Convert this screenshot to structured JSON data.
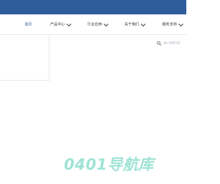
{
  "nav": {
    "items": [
      {
        "label": "首页",
        "active": true,
        "has_dropdown": false
      },
      {
        "label": "产品中心",
        "active": false,
        "has_dropdown": true
      },
      {
        "label": "行业应用",
        "active": false,
        "has_dropdown": true
      },
      {
        "label": "关于我们",
        "active": false,
        "has_dropdown": true
      },
      {
        "label": "服务支持",
        "active": false,
        "has_dropdown": true
      }
    ]
  },
  "search": {
    "placeholder": "输入搜索内容",
    "icon": "search-icon"
  },
  "watermark": {
    "text": "0401导航库"
  },
  "colors": {
    "brand_blue": "#2f5d9b",
    "watermark": "#9fe3d6"
  }
}
